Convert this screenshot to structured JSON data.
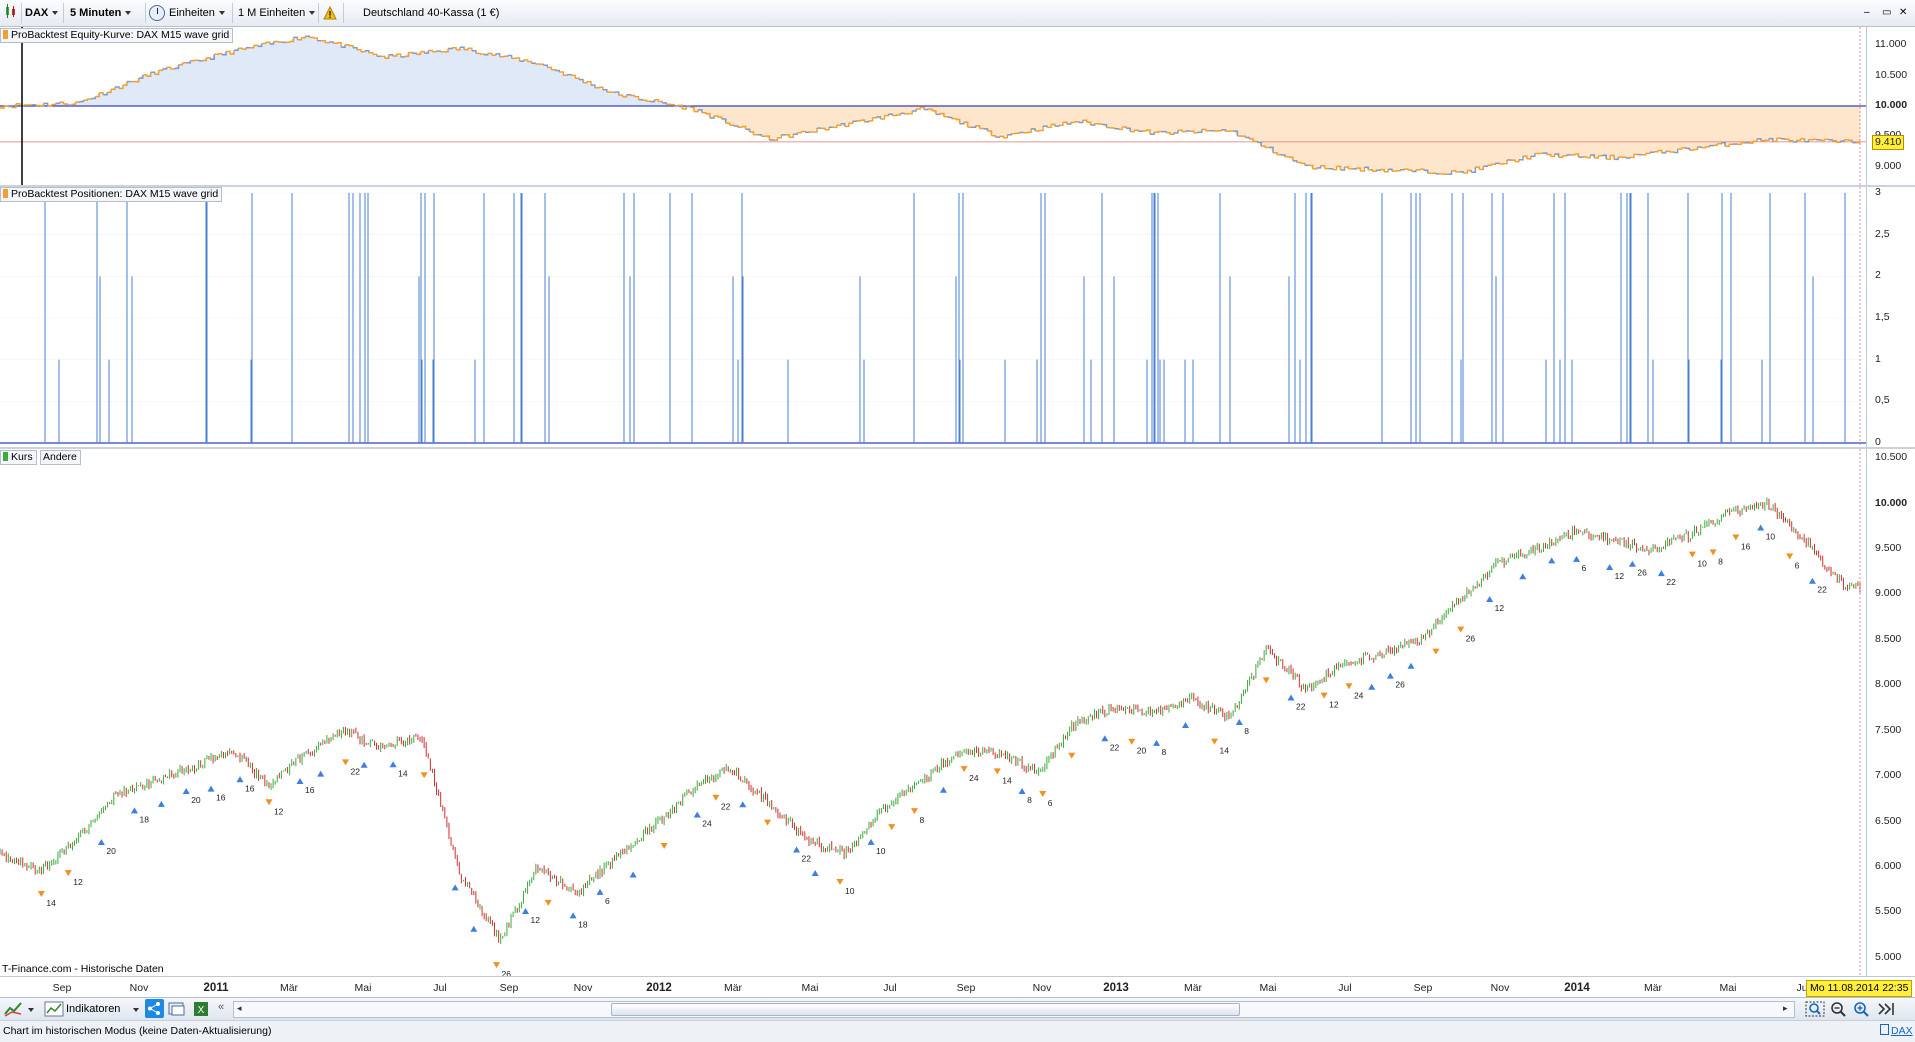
{
  "toolbar": {
    "symbol": "DAX",
    "timeframe": "5 Minuten",
    "units": "Einheiten",
    "units_count": "1 M Einheiten",
    "instrument": "Deutschland 40-Kassa (1 €)"
  },
  "panels": {
    "equity_label": "ProBacktest Equity-Kurve: DAX M15 wave grid",
    "positions_label": "ProBacktest Positionen: DAX M15 wave grid",
    "price_label_1": "Kurs",
    "price_label_2": "Andere"
  },
  "equity_axis": [
    "11.000",
    "10.500",
    "10.000",
    "9.500",
    "9.000"
  ],
  "equity_current": "9.410",
  "positions_axis": [
    "3",
    "2,5",
    "2",
    "1,5",
    "1",
    "0,5",
    "0"
  ],
  "price_axis": [
    "10.500",
    "10.000",
    "9.500",
    "9.000",
    "8.500",
    "8.000",
    "7.500",
    "7.000",
    "6.500",
    "6.000",
    "5.500",
    "5.000"
  ],
  "x_axis": [
    {
      "label": "Sep",
      "year": false
    },
    {
      "label": "Nov",
      "year": false
    },
    {
      "label": "2011",
      "year": true
    },
    {
      "label": "Mär",
      "year": false
    },
    {
      "label": "Mai",
      "year": false
    },
    {
      "label": "Jul",
      "year": false
    },
    {
      "label": "Sep",
      "year": false
    },
    {
      "label": "Nov",
      "year": false
    },
    {
      "label": "2012",
      "year": true
    },
    {
      "label": "Mär",
      "year": false
    },
    {
      "label": "Mai",
      "year": false
    },
    {
      "label": "Jul",
      "year": false
    },
    {
      "label": "Sep",
      "year": false
    },
    {
      "label": "Nov",
      "year": false
    },
    {
      "label": "2013",
      "year": true
    },
    {
      "label": "Mär",
      "year": false
    },
    {
      "label": "Mai",
      "year": false
    },
    {
      "label": "Jul",
      "year": false
    },
    {
      "label": "Sep",
      "year": false
    },
    {
      "label": "Nov",
      "year": false
    },
    {
      "label": "2014",
      "year": true
    },
    {
      "label": "Mär",
      "year": false
    },
    {
      "label": "Mai",
      "year": false
    },
    {
      "label": "Ju",
      "year": false
    }
  ],
  "cursor_date": "Mo 11.08.2014 22:35",
  "source": "T-Finance.com - Historische Daten",
  "bottom": {
    "indicators": "Indikatoren",
    "right_symbol": "DAX"
  },
  "status": "Chart im historischen Modus (keine Daten-Aktualisierung)",
  "colors": {
    "equity_up": "#7a9bd1",
    "equity_down": "#f0a030",
    "equity_fill_above": "#dfe9f8",
    "equity_fill_below": "#fde6cc",
    "baseline": "#3040c0",
    "positions": "#4a7fd6",
    "candle_up": "#3caa3c",
    "candle_down": "#cc3030",
    "current_value_bg": "#ffef3a"
  },
  "chart_data": [
    {
      "type": "line",
      "title": "ProBacktest Equity-Kurve: DAX M15 wave grid",
      "ylim": [
        8700,
        11300
      ],
      "baseline": 10000,
      "current": 9410,
      "x": [
        "2010-08",
        "2010-10",
        "2010-12",
        "2011-02",
        "2011-04",
        "2011-06",
        "2011-08",
        "2011-10",
        "2011-12",
        "2012-02",
        "2012-04",
        "2012-06",
        "2012-08",
        "2012-10",
        "2012-12",
        "2013-02",
        "2013-04",
        "2013-06",
        "2013-08",
        "2013-10",
        "2013-12",
        "2014-02",
        "2014-04",
        "2014-06",
        "2014-08"
      ],
      "values": [
        10000,
        10050,
        10550,
        10900,
        11150,
        10800,
        10950,
        10700,
        10200,
        9950,
        9450,
        9700,
        9950,
        9500,
        9750,
        9550,
        9600,
        9000,
        8950,
        8900,
        9200,
        9150,
        9300,
        9450,
        9410
      ]
    },
    {
      "type": "bar",
      "title": "ProBacktest Positionen: DAX M15 wave grid",
      "ylim": [
        0,
        3
      ],
      "values_observed": [
        0,
        1,
        2,
        3
      ]
    },
    {
      "type": "line",
      "title": "Kurs",
      "ylim": [
        4800,
        10600
      ],
      "x": [
        "2010-08",
        "2010-09",
        "2010-10",
        "2010-11",
        "2010-12",
        "2011-01",
        "2011-02",
        "2011-03",
        "2011-04",
        "2011-05",
        "2011-06",
        "2011-07",
        "2011-08",
        "2011-09",
        "2011-10",
        "2011-11",
        "2011-12",
        "2012-01",
        "2012-02",
        "2012-03",
        "2012-04",
        "2012-05",
        "2012-06",
        "2012-07",
        "2012-08",
        "2012-09",
        "2012-10",
        "2012-11",
        "2012-12",
        "2013-01",
        "2013-02",
        "2013-03",
        "2013-04",
        "2013-05",
        "2013-06",
        "2013-07",
        "2013-08",
        "2013-09",
        "2013-10",
        "2013-11",
        "2013-12",
        "2014-01",
        "2014-02",
        "2014-03",
        "2014-04",
        "2014-05",
        "2014-06",
        "2014-07",
        "2014-08"
      ],
      "values": [
        6150,
        5950,
        6300,
        6800,
        6950,
        7100,
        7300,
        6900,
        7250,
        7500,
        7300,
        7450,
        5900,
        5200,
        6000,
        5700,
        6100,
        6450,
        6850,
        7100,
        6700,
        6300,
        6150,
        6650,
        6950,
        7300,
        7250,
        7050,
        7600,
        7750,
        7700,
        7850,
        7650,
        8400,
        7950,
        8250,
        8350,
        8500,
        8950,
        9350,
        9500,
        9700,
        9600,
        9500,
        9650,
        9900,
        10000,
        9600,
        9100
      ]
    }
  ]
}
